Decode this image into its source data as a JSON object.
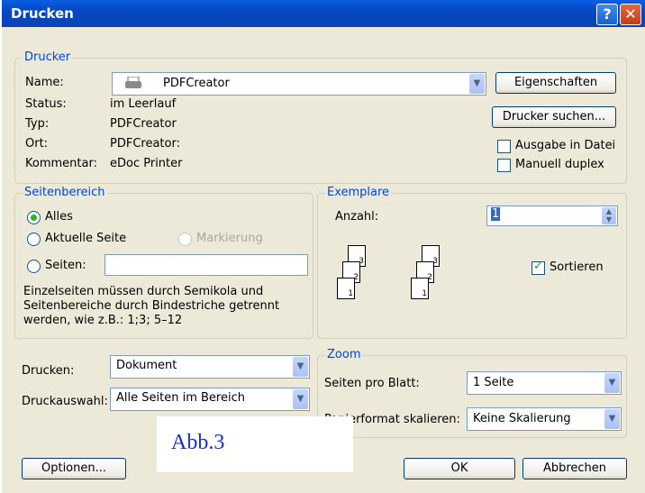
{
  "window": {
    "title": "Drucken"
  },
  "printer": {
    "legend": "Drucker",
    "name_label": "Name:",
    "name_value": "PDFCreator",
    "status_label": "Status:",
    "status_value": "im Leerlauf",
    "type_label": "Typ:",
    "type_value": "PDFCreator",
    "location_label": "Ort:",
    "location_value": "PDFCreator:",
    "comment_label": "Kommentar:",
    "comment_value": "eDoc Printer",
    "properties_button": "Eigenschaften",
    "find_button": "Drucker suchen...",
    "print_to_file": "Ausgabe in Datei",
    "manual_duplex": "Manuell duplex"
  },
  "page_range": {
    "legend": "Seitenbereich",
    "all": "Alles",
    "current": "Aktuelle Seite",
    "selection": "Markierung",
    "pages": "Seiten:",
    "pages_value": "",
    "help": [
      "Einzelseiten müssen durch Semikola und",
      "Seitenbereiche durch Bindestriche getrennt",
      "werden, wie z.B.: 1;3; 5–12"
    ]
  },
  "copies": {
    "legend": "Exemplare",
    "count_label": "Anzahl:",
    "count_value": "1",
    "collate": "Sortieren",
    "stack_labels": [
      "3",
      "2",
      "1"
    ]
  },
  "print": {
    "print_label": "Drucken:",
    "print_value": "Dokument",
    "print_what_label": "Druckauswahl:",
    "print_what_value": "Alle Seiten im Bereich"
  },
  "zoom": {
    "legend": "Zoom",
    "pages_per_sheet_label": "Seiten pro Blatt:",
    "pages_per_sheet_value": "1 Seite",
    "scale_label": "Papierformat skalieren:",
    "scale_value": "Keine Skalierung"
  },
  "buttons": {
    "options": "Optionen...",
    "ok": "OK",
    "cancel": "Abbrechen"
  },
  "annotation": "Abb.3"
}
